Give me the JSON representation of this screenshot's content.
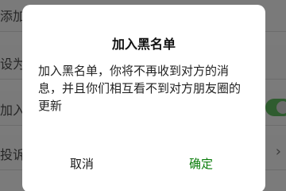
{
  "background": {
    "rows": [
      {
        "label": "添加",
        "trailing": "none"
      },
      {
        "label": "设为",
        "trailing": "none"
      },
      {
        "label": "加入",
        "trailing": "toggle-on"
      },
      {
        "label": "投诉",
        "trailing": "chevron"
      }
    ],
    "chevron_glyph": "›",
    "toggle_color": "#2f5c2f"
  },
  "dialog": {
    "title": "加入黑名单",
    "message": "加入黑名单，你将不再收到对方的消息，并且你们相互看不到对方朋友圈的更新",
    "cancel_label": "取消",
    "confirm_label": "确定",
    "confirm_color": "#0a7c0a"
  }
}
